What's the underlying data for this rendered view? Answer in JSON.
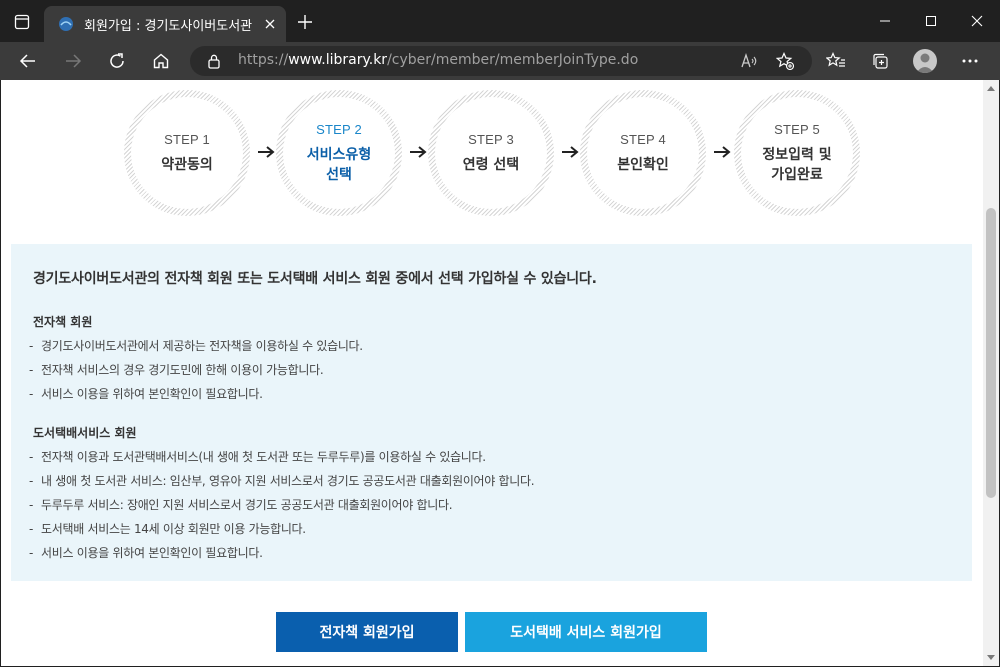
{
  "browser": {
    "tab_title": "회원가입 : 경기도사이버도서관",
    "url_scheme": "https://",
    "url_domain": "www.library.kr",
    "url_path": "/cyber/member/memberJoinType.do"
  },
  "steps": [
    {
      "num": "STEP 1",
      "name": "약관동의",
      "active": false
    },
    {
      "num": "STEP 2",
      "name": "서비스유형\n선택",
      "name_line1": "서비스유형",
      "name_line2": "선택",
      "active": true
    },
    {
      "num": "STEP 3",
      "name": "연령 선택",
      "active": false
    },
    {
      "num": "STEP 4",
      "name": "본인확인",
      "active": false
    },
    {
      "num": "STEP 5",
      "name_line1": "정보입력 및",
      "name_line2": "가입완료",
      "active": false
    }
  ],
  "info": {
    "lead": "경기도사이버도서관의 전자책 회원 또는 도서택배 서비스 회원 중에서 선택 가입하실 수 있습니다.",
    "ebook": {
      "title": "전자책 회원",
      "items": [
        "경기도사이버도서관에서 제공하는 전자책을 이용하실 수 있습니다.",
        "전자책 서비스의 경우 경기도민에 한해 이용이 가능합니다.",
        "서비스 이용을 위하여 본인확인이 필요합니다."
      ]
    },
    "delivery": {
      "title": "도서택배서비스 회원",
      "items": [
        "전자책 이용과 도서관택배서비스(내 생애 첫 도서관 또는 두루두루)를 이용하실 수 있습니다.",
        "내 생애 첫 도서관 서비스: 임산부, 영유아 지원 서비스로서 경기도 공공도서관 대출회원이어야 합니다.",
        "두루두루 서비스: 장애인 지원 서비스로서 경기도 공공도서관 대출회원이어야 합니다.",
        "도서택배 서비스는 14세 이상 회원만 이용 가능합니다.",
        "서비스 이용을 위하여 본인확인이 필요합니다."
      ]
    },
    "dash": "-"
  },
  "buttons": {
    "ebook_join": "전자책 회원가입",
    "delivery_join": "도서택배 서비스 회원가입"
  },
  "colors": {
    "ebook_button": "#0a5fae",
    "delivery_button": "#1aa3de",
    "info_background": "#eaf5fa",
    "active_step": "#0b5fa8"
  }
}
